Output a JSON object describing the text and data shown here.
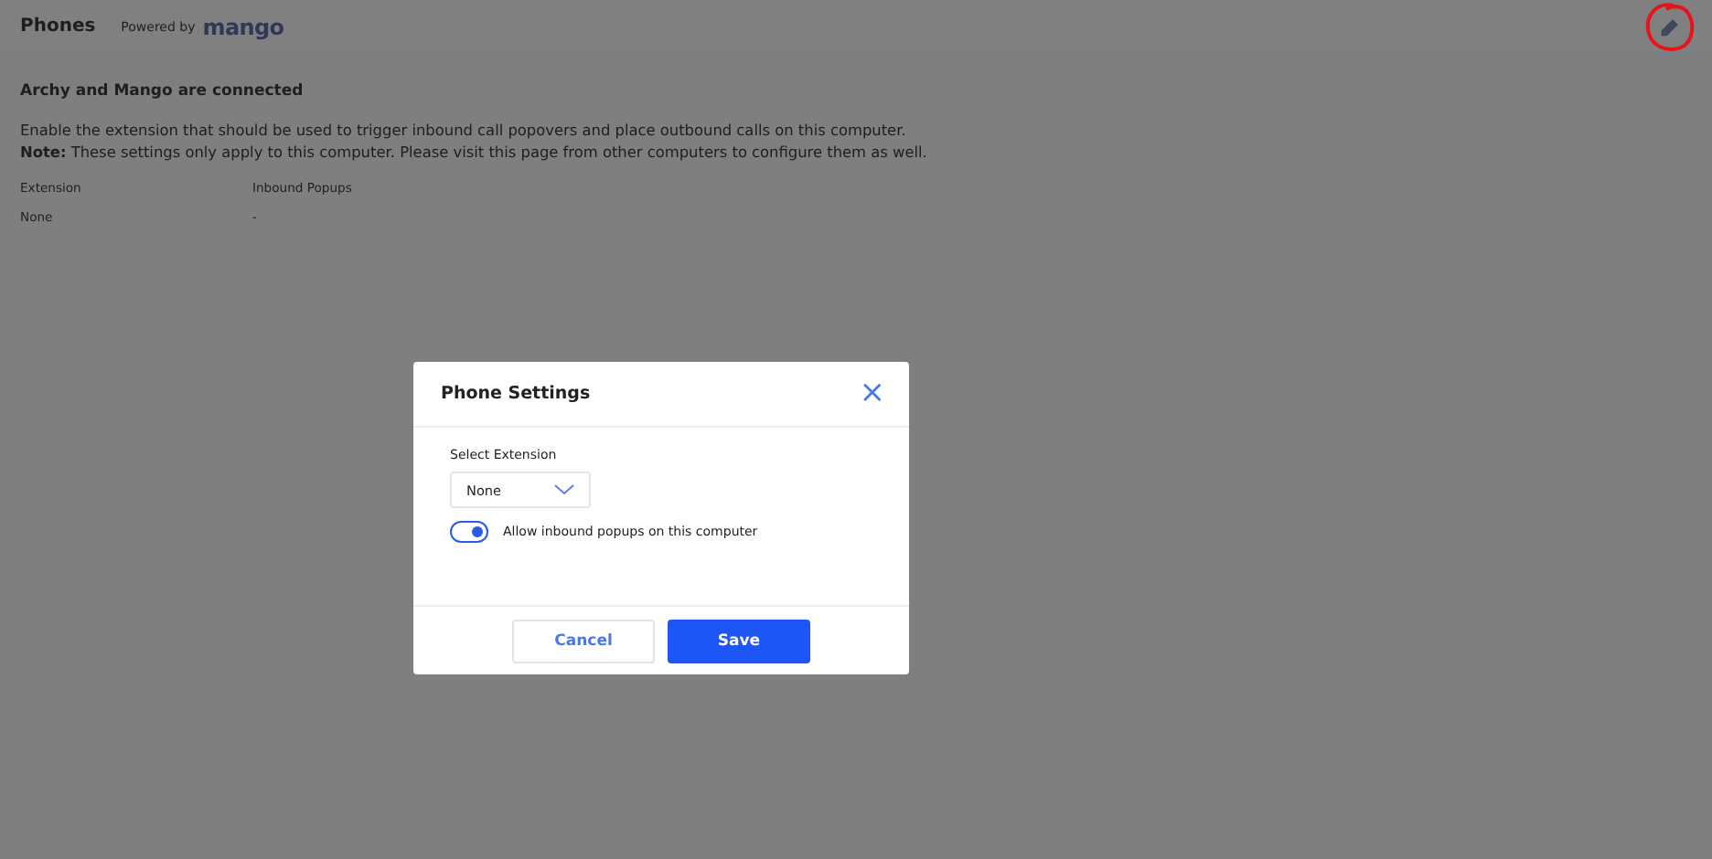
{
  "header": {
    "title": "Phones",
    "powered_by": "Powered by",
    "brand": "mango"
  },
  "heading": "Archy and Mango are connected",
  "description": "Enable the extension that should be used to trigger inbound call popovers and place outbound calls on this computer.",
  "note": "**Note:** These settings only apply to this computer. Please visit this page from other computers to configure them as well.",
  "table": {
    "columns": [
      "Extension",
      "Inbound Popups"
    ],
    "rows": [
      [
        "None",
        "-"
      ]
    ]
  },
  "dialog": {
    "title": "Phone Settings",
    "close": "×",
    "field_label": "Select Extension",
    "select_value": "None",
    "toggle": {
      "label": "Allow inbound popups on this computer",
      "on": true
    },
    "buttons": [
      {
        "label": "Cancel",
        "kind": "secondary"
      },
      {
        "label": "Save",
        "kind": "primary"
      }
    ]
  }
}
